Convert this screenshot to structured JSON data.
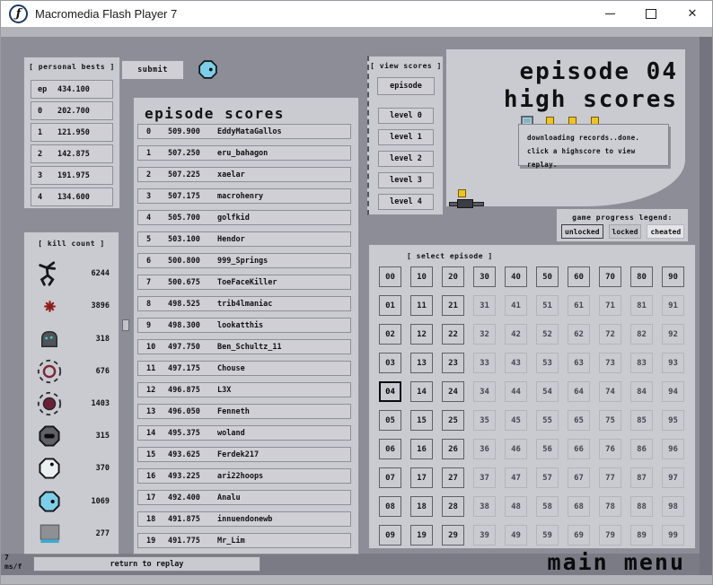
{
  "window": {
    "title": "Macromedia Flash Player 7",
    "controls": [
      "minimize",
      "maximize",
      "close"
    ]
  },
  "top": {
    "submit_label": "submit",
    "player_icon": "chaingun-drone-icon"
  },
  "personal_bests": {
    "label": "[ personal bests ]",
    "rows": [
      {
        "key": "ep",
        "value": "434.100"
      },
      {
        "key": "0",
        "value": "202.700"
      },
      {
        "key": "1",
        "value": "121.950"
      },
      {
        "key": "2",
        "value": "142.875"
      },
      {
        "key": "3",
        "value": "191.975"
      },
      {
        "key": "4",
        "value": "134.600"
      }
    ]
  },
  "kill_count": {
    "label": "[ kill count ]",
    "rows": [
      {
        "icon": "ninja-icon",
        "count": "6244"
      },
      {
        "icon": "mine-icon",
        "count": "3896"
      },
      {
        "icon": "turret-icon",
        "count": "318"
      },
      {
        "icon": "seeker-ring-icon",
        "count": "676"
      },
      {
        "icon": "seeker-filled-icon",
        "count": "1403"
      },
      {
        "icon": "zap-drone-icon",
        "count": "315"
      },
      {
        "icon": "laser-drone-icon",
        "count": "370"
      },
      {
        "icon": "chaingun-drone-icon",
        "count": "1069"
      },
      {
        "icon": "thwump-icon",
        "count": "277"
      }
    ]
  },
  "episode_scores": {
    "title": "episode scores",
    "rows": [
      {
        "rank": "0",
        "score": "509.900",
        "name": "EddyMataGallos"
      },
      {
        "rank": "1",
        "score": "507.250",
        "name": "eru_bahagon"
      },
      {
        "rank": "2",
        "score": "507.225",
        "name": "xaelar"
      },
      {
        "rank": "3",
        "score": "507.175",
        "name": "macrohenry"
      },
      {
        "rank": "4",
        "score": "505.700",
        "name": "golfkid"
      },
      {
        "rank": "5",
        "score": "503.100",
        "name": "Hendor"
      },
      {
        "rank": "6",
        "score": "500.800",
        "name": "999_Springs"
      },
      {
        "rank": "7",
        "score": "500.675",
        "name": "ToeFaceKiller"
      },
      {
        "rank": "8",
        "score": "498.525",
        "name": "trib4lmaniac"
      },
      {
        "rank": "9",
        "score": "498.300",
        "name": "lookatthis"
      },
      {
        "rank": "10",
        "score": "497.750",
        "name": "Ben_Schultz_11"
      },
      {
        "rank": "11",
        "score": "497.175",
        "name": "Chouse"
      },
      {
        "rank": "12",
        "score": "496.875",
        "name": "L3X"
      },
      {
        "rank": "13",
        "score": "496.050",
        "name": "Fenneth"
      },
      {
        "rank": "14",
        "score": "495.375",
        "name": "woland"
      },
      {
        "rank": "15",
        "score": "493.625",
        "name": "Ferdek217"
      },
      {
        "rank": "16",
        "score": "493.225",
        "name": "ari22hoops"
      },
      {
        "rank": "17",
        "score": "492.400",
        "name": "Analu"
      },
      {
        "rank": "18",
        "score": "491.875",
        "name": "innuendonewb"
      },
      {
        "rank": "19",
        "score": "491.775",
        "name": "Mr_Lim"
      }
    ]
  },
  "view_scores": {
    "label": "[ view scores ]",
    "buttons": [
      "episode",
      "level 0",
      "level 1",
      "level 2",
      "level 3",
      "level 4"
    ]
  },
  "heading": {
    "line1": "episode 04",
    "line2": "high scores"
  },
  "status_tooltip": {
    "line1": "downloading records..done.",
    "line2": "click a highscore to view replay."
  },
  "legend": {
    "label": "game progress legend:",
    "items": [
      {
        "label": "unlocked",
        "state": "unlocked"
      },
      {
        "label": "locked",
        "state": "locked"
      },
      {
        "label": "cheated",
        "state": "cheated"
      }
    ]
  },
  "select_episode": {
    "label": "[ select episode ]",
    "selected": "04",
    "cells": [
      {
        "label": "00",
        "state": "unlocked"
      },
      {
        "label": "10",
        "state": "unlocked"
      },
      {
        "label": "20",
        "state": "unlocked"
      },
      {
        "label": "30",
        "state": "unlocked"
      },
      {
        "label": "40",
        "state": "unlocked"
      },
      {
        "label": "50",
        "state": "unlocked"
      },
      {
        "label": "60",
        "state": "unlocked"
      },
      {
        "label": "70",
        "state": "unlocked"
      },
      {
        "label": "80",
        "state": "unlocked"
      },
      {
        "label": "90",
        "state": "unlocked"
      },
      {
        "label": "01",
        "state": "unlocked"
      },
      {
        "label": "11",
        "state": "unlocked"
      },
      {
        "label": "21",
        "state": "unlocked"
      },
      {
        "label": "31",
        "state": "locked"
      },
      {
        "label": "41",
        "state": "locked"
      },
      {
        "label": "51",
        "state": "locked"
      },
      {
        "label": "61",
        "state": "locked"
      },
      {
        "label": "71",
        "state": "locked"
      },
      {
        "label": "81",
        "state": "locked"
      },
      {
        "label": "91",
        "state": "locked"
      },
      {
        "label": "02",
        "state": "unlocked"
      },
      {
        "label": "12",
        "state": "unlocked"
      },
      {
        "label": "22",
        "state": "unlocked"
      },
      {
        "label": "32",
        "state": "locked"
      },
      {
        "label": "42",
        "state": "locked"
      },
      {
        "label": "52",
        "state": "locked"
      },
      {
        "label": "62",
        "state": "locked"
      },
      {
        "label": "72",
        "state": "locked"
      },
      {
        "label": "82",
        "state": "locked"
      },
      {
        "label": "92",
        "state": "locked"
      },
      {
        "label": "03",
        "state": "unlocked"
      },
      {
        "label": "13",
        "state": "unlocked"
      },
      {
        "label": "23",
        "state": "unlocked"
      },
      {
        "label": "33",
        "state": "locked"
      },
      {
        "label": "43",
        "state": "locked"
      },
      {
        "label": "53",
        "state": "locked"
      },
      {
        "label": "63",
        "state": "locked"
      },
      {
        "label": "73",
        "state": "locked"
      },
      {
        "label": "83",
        "state": "locked"
      },
      {
        "label": "93",
        "state": "locked"
      },
      {
        "label": "04",
        "state": "selected"
      },
      {
        "label": "14",
        "state": "unlocked"
      },
      {
        "label": "24",
        "state": "unlocked"
      },
      {
        "label": "34",
        "state": "locked"
      },
      {
        "label": "44",
        "state": "locked"
      },
      {
        "label": "54",
        "state": "locked"
      },
      {
        "label": "64",
        "state": "locked"
      },
      {
        "label": "74",
        "state": "locked"
      },
      {
        "label": "84",
        "state": "locked"
      },
      {
        "label": "94",
        "state": "locked"
      },
      {
        "label": "05",
        "state": "unlocked"
      },
      {
        "label": "15",
        "state": "unlocked"
      },
      {
        "label": "25",
        "state": "unlocked"
      },
      {
        "label": "35",
        "state": "locked"
      },
      {
        "label": "45",
        "state": "locked"
      },
      {
        "label": "55",
        "state": "locked"
      },
      {
        "label": "65",
        "state": "locked"
      },
      {
        "label": "75",
        "state": "locked"
      },
      {
        "label": "85",
        "state": "locked"
      },
      {
        "label": "95",
        "state": "locked"
      },
      {
        "label": "06",
        "state": "unlocked"
      },
      {
        "label": "16",
        "state": "unlocked"
      },
      {
        "label": "26",
        "state": "unlocked"
      },
      {
        "label": "36",
        "state": "locked"
      },
      {
        "label": "46",
        "state": "locked"
      },
      {
        "label": "56",
        "state": "locked"
      },
      {
        "label": "66",
        "state": "locked"
      },
      {
        "label": "76",
        "state": "locked"
      },
      {
        "label": "86",
        "state": "locked"
      },
      {
        "label": "96",
        "state": "locked"
      },
      {
        "label": "07",
        "state": "unlocked"
      },
      {
        "label": "17",
        "state": "unlocked"
      },
      {
        "label": "27",
        "state": "unlocked"
      },
      {
        "label": "37",
        "state": "locked"
      },
      {
        "label": "47",
        "state": "locked"
      },
      {
        "label": "57",
        "state": "locked"
      },
      {
        "label": "67",
        "state": "locked"
      },
      {
        "label": "77",
        "state": "locked"
      },
      {
        "label": "87",
        "state": "locked"
      },
      {
        "label": "97",
        "state": "locked"
      },
      {
        "label": "08",
        "state": "unlocked"
      },
      {
        "label": "18",
        "state": "unlocked"
      },
      {
        "label": "28",
        "state": "unlocked"
      },
      {
        "label": "38",
        "state": "locked"
      },
      {
        "label": "48",
        "state": "locked"
      },
      {
        "label": "58",
        "state": "locked"
      },
      {
        "label": "68",
        "state": "locked"
      },
      {
        "label": "78",
        "state": "locked"
      },
      {
        "label": "88",
        "state": "locked"
      },
      {
        "label": "98",
        "state": "locked"
      },
      {
        "label": "09",
        "state": "unlocked"
      },
      {
        "label": "19",
        "state": "unlocked"
      },
      {
        "label": "29",
        "state": "unlocked"
      },
      {
        "label": "39",
        "state": "locked"
      },
      {
        "label": "49",
        "state": "locked"
      },
      {
        "label": "59",
        "state": "locked"
      },
      {
        "label": "69",
        "state": "locked"
      },
      {
        "label": "79",
        "state": "locked"
      },
      {
        "label": "89",
        "state": "locked"
      },
      {
        "label": "99",
        "state": "locked"
      }
    ]
  },
  "footer": {
    "ms_value": "7",
    "ms_unit": "ms/f",
    "return_label": "return to replay",
    "main_menu_label": "main menu"
  },
  "colors": {
    "gold": "#efc41d",
    "drone_blue": "#7ccfe8",
    "mine_red": "#8f1d17",
    "thwump_blue": "#3fa9cf",
    "panel": "#cacad1",
    "background": "#8d8d97"
  }
}
